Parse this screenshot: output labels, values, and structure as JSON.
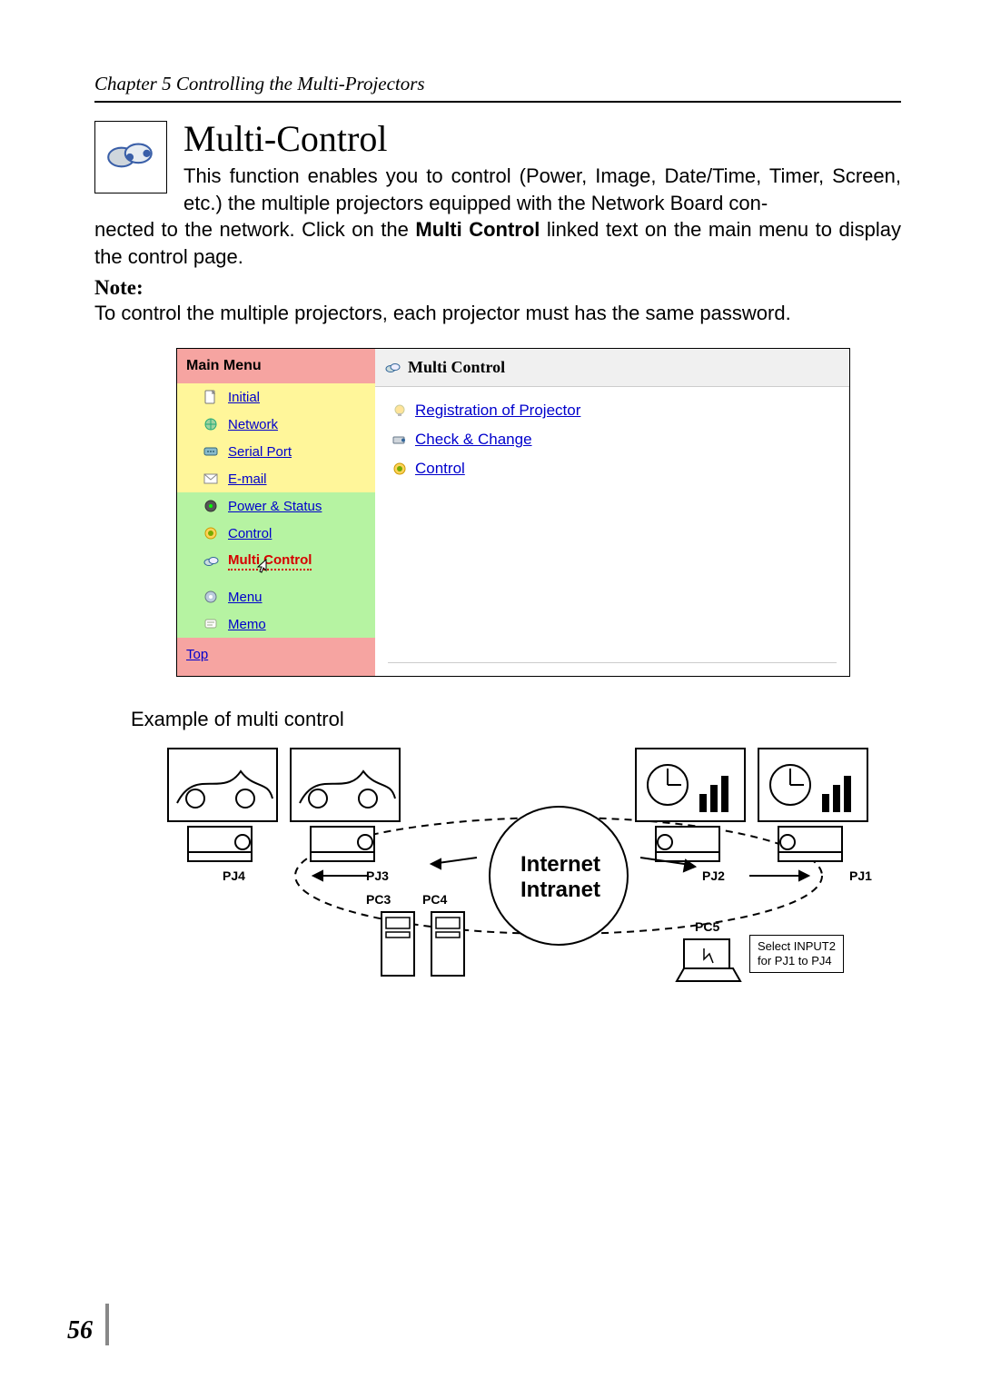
{
  "header": {
    "chapter": "Chapter 5 Controlling the Multi-Projectors"
  },
  "section": {
    "title": "Multi-Control",
    "paragraph": "This function enables you to control (Power, Image, Date/Time, Timer, Screen, etc.) the multiple projectors equipped with the Network Board connected to the network. Click on the Multi Control linked text on the main menu to display the control page.",
    "note_label": "Note:",
    "note_text": "To control the multiple projectors, each projector must has the same password."
  },
  "ui": {
    "left": {
      "title": "Main Menu",
      "groups": {
        "yellow": [
          "Initial",
          "Network",
          "Serial Port",
          "E-mail"
        ],
        "green": [
          "Power & Status",
          "Control",
          "Multi Control",
          "Menu",
          "Memo"
        ]
      },
      "top_link": "Top"
    },
    "right": {
      "title": "Multi Control",
      "links": [
        "Registration of Projector",
        "Check & Change",
        "Control"
      ]
    }
  },
  "example": {
    "caption": "Example of multi control",
    "center": {
      "line1": "Internet",
      "line2": "Intranet"
    },
    "labels": {
      "pj1": "PJ1",
      "pj2": "PJ2",
      "pj3": "PJ3",
      "pj4": "PJ4",
      "pc3": "PC3",
      "pc4": "PC4",
      "pc5": "PC5"
    },
    "callout": {
      "line1": "Select INPUT2",
      "line2": "for PJ1 to PJ4"
    }
  },
  "page_number": "56"
}
